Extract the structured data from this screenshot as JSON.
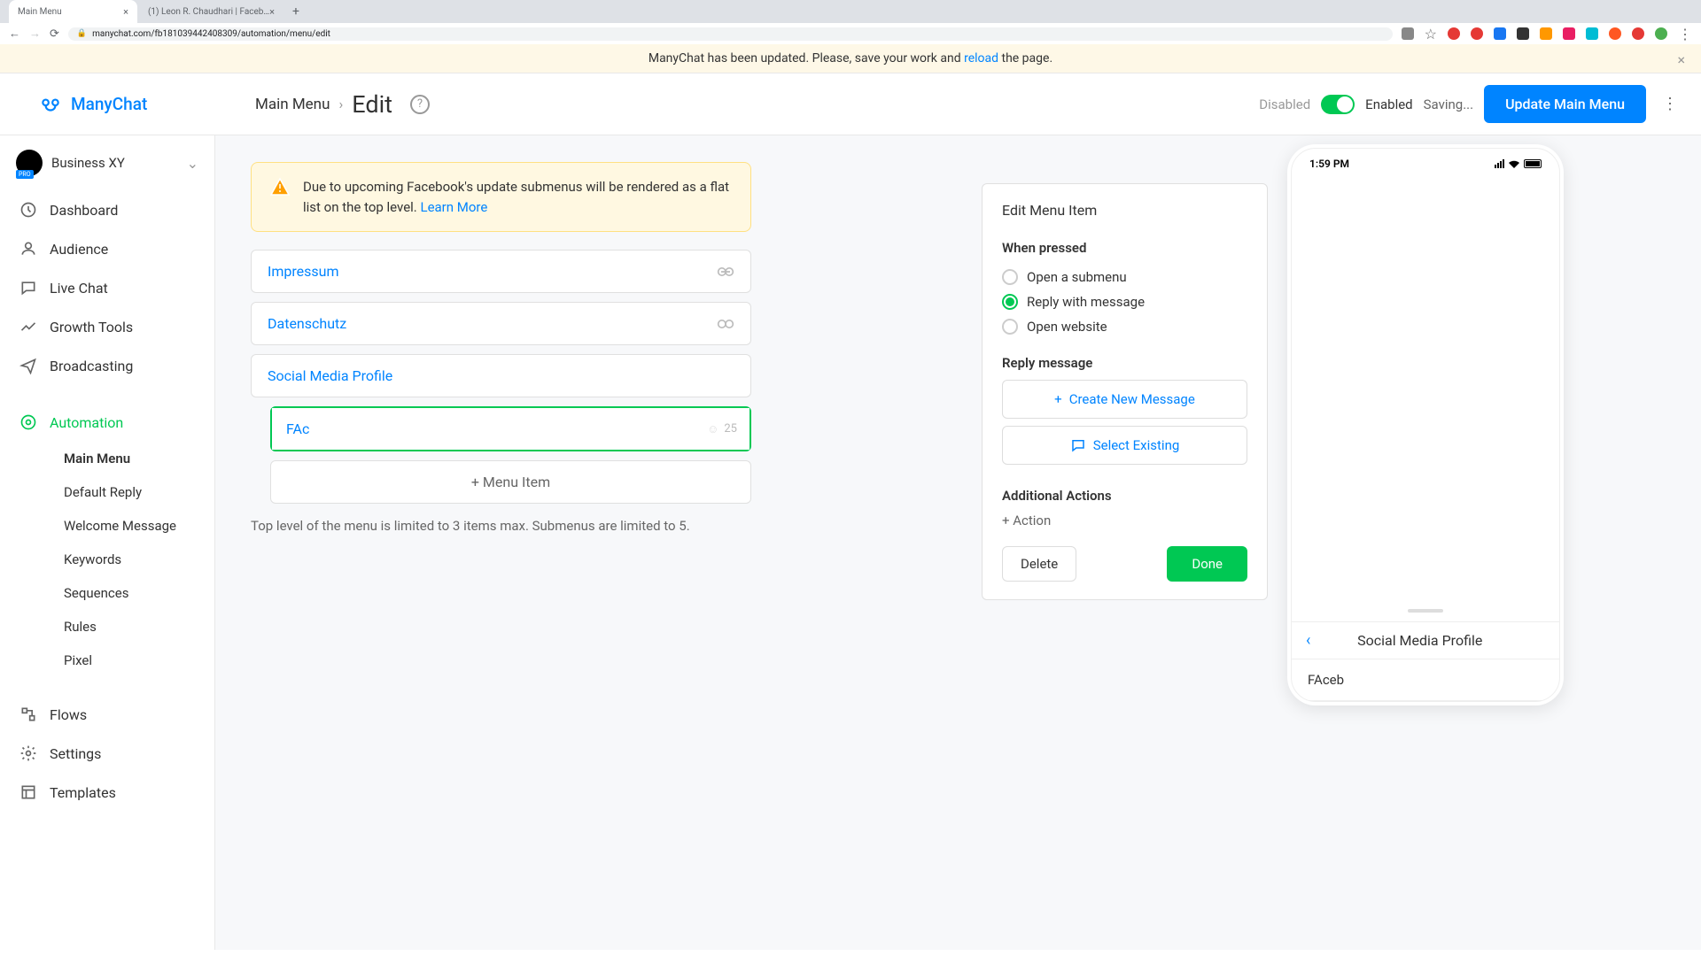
{
  "browser": {
    "tabs": [
      {
        "title": "Main Menu",
        "active": true
      },
      {
        "title": "(1) Leon R. Chaudhari | Faceb…",
        "active": false
      }
    ],
    "url": "manychat.com/fb181039442408309/automation/menu/edit"
  },
  "notif": {
    "text_prefix": "ManyChat has been updated. Please, save your work and ",
    "link": "reload",
    "text_suffix": " the page."
  },
  "header": {
    "logo": "ManyChat",
    "crumb1": "Main Menu",
    "crumb2": "Edit",
    "disabled": "Disabled",
    "enabled": "Enabled",
    "saving": "Saving...",
    "update": "Update Main Menu"
  },
  "sidebar": {
    "workspace": "Business XY",
    "items": [
      "Dashboard",
      "Audience",
      "Live Chat",
      "Growth Tools",
      "Broadcasting",
      "Automation",
      "Flows",
      "Settings",
      "Templates"
    ],
    "sub": [
      "Main Menu",
      "Default Reply",
      "Welcome Message",
      "Keywords",
      "Sequences",
      "Rules",
      "Pixel"
    ]
  },
  "alert": {
    "text": "Due to upcoming Facebook's update submenus will be rendered as a flat list on the top level. ",
    "link": "Learn More"
  },
  "menu": {
    "items": [
      "Impressum",
      "Datenschutz",
      "Social Media Profile"
    ],
    "editing_value": "FAc",
    "char_count": "25",
    "add": "+ Menu Item",
    "hint": "Top level of the menu is limited to 3 items max. Submenus are limited to 5."
  },
  "panel": {
    "title": "Edit Menu Item",
    "when": "When pressed",
    "opt_submenu": "Open a submenu",
    "opt_reply": "Reply with message",
    "opt_website": "Open website",
    "reply_h": "Reply message",
    "create": "Create New Message",
    "select": "Select Existing",
    "add_h": "Additional Actions",
    "add_action": "+ Action",
    "delete": "Delete",
    "done": "Done"
  },
  "phone": {
    "time": "1:59 PM",
    "nav_title": "Social Media Profile",
    "item": "FAceb"
  }
}
